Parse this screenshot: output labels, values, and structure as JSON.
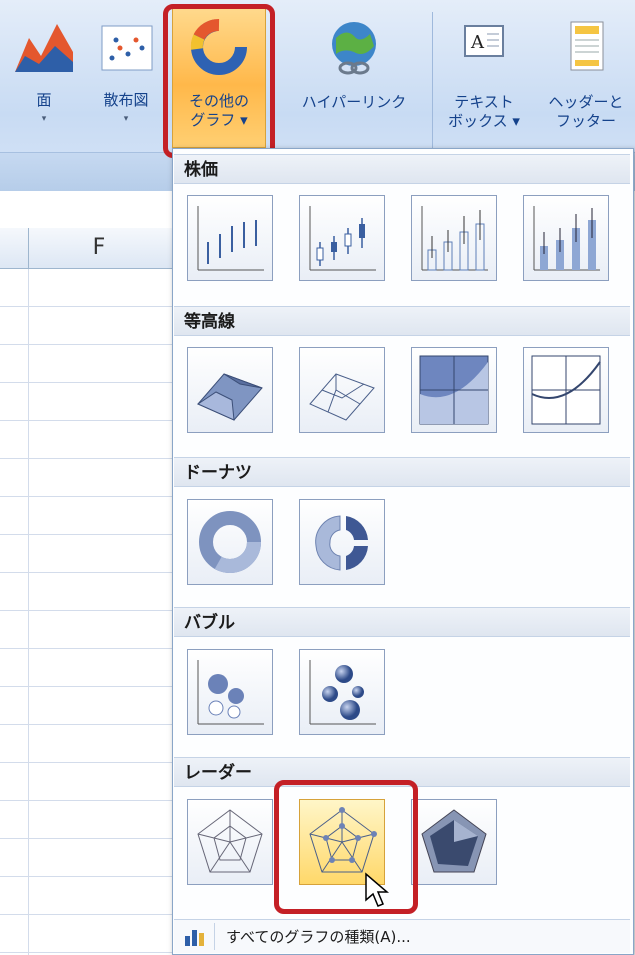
{
  "ribbon": {
    "buttons": [
      {
        "name": "area-chart-button",
        "line1": "面",
        "line2": "▾"
      },
      {
        "name": "scatter-chart-button",
        "line1": "散布図",
        "line2": "▾"
      },
      {
        "name": "other-charts-button",
        "line1": "その他の",
        "line2": "グラフ ▾"
      },
      {
        "name": "hyperlink-button",
        "line1": "ハイパーリンク",
        "line2": ""
      },
      {
        "name": "textbox-button",
        "line1": "テキスト",
        "line2": "ボックス ▾"
      },
      {
        "name": "header-footer-button",
        "line1": "ヘッダーと",
        "line2": "フッター"
      }
    ]
  },
  "sheet": {
    "column_label": "F"
  },
  "gallery": {
    "sections": [
      {
        "title": "株価"
      },
      {
        "title": "等高線"
      },
      {
        "title": "ドーナツ"
      },
      {
        "title": "バブル"
      },
      {
        "title": "レーダー"
      }
    ],
    "footer_label": "すべてのグラフの種類(A)..."
  },
  "colors": {
    "highlight": "#c42026",
    "selected_tile": "#ffd86a",
    "section_header": "#dfe6f0"
  }
}
